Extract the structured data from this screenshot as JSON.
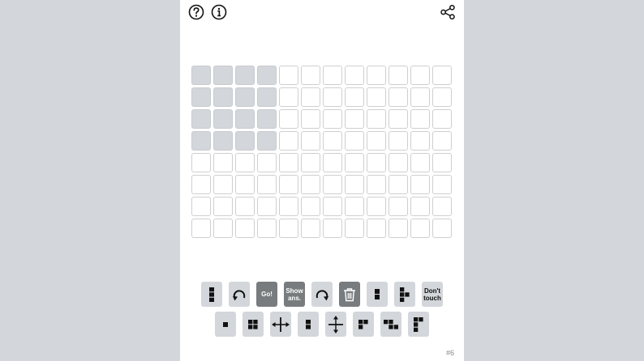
{
  "header": {
    "help_icon": "question-circle-icon",
    "info_icon": "info-circle-icon",
    "share_icon": "share-icon"
  },
  "grid": {
    "rows": 8,
    "cols": 12,
    "filled_region": {
      "rows": 4,
      "cols": 4
    },
    "filled_color": "#d3d6da"
  },
  "toolbar_row1": [
    {
      "name": "piece-vertical-3-button",
      "icon": "vertical-bar-3-icon"
    },
    {
      "name": "undo-button",
      "icon": "rotate-left-icon"
    },
    {
      "name": "go-button",
      "label": "Go!"
    },
    {
      "name": "show-answer-button",
      "label": "Show ans."
    },
    {
      "name": "redo-button",
      "icon": "rotate-right-icon"
    },
    {
      "name": "trash-button",
      "icon": "trash-icon"
    },
    {
      "name": "piece-vertical-2-button",
      "icon": "vertical-bar-2-icon"
    },
    {
      "name": "piece-t-button",
      "icon": "t-piece-icon"
    },
    {
      "name": "dont-touch-button",
      "label": "Don't touch"
    }
  ],
  "toolbar_row2": [
    {
      "name": "piece-single-button",
      "icon": "single-square-icon"
    },
    {
      "name": "piece-square-button",
      "icon": "square-2x2-icon"
    },
    {
      "name": "flip-horizontal-button",
      "icon": "flip-horizontal-icon"
    },
    {
      "name": "piece-vertical-2b-button",
      "icon": "vertical-bar-2-icon"
    },
    {
      "name": "flip-vertical-button",
      "icon": "flip-vertical-icon"
    },
    {
      "name": "piece-corner-button",
      "icon": "corner-piece-icon"
    },
    {
      "name": "piece-z-button",
      "icon": "z-piece-icon"
    },
    {
      "name": "piece-l-button",
      "icon": "l-piece-icon"
    }
  ],
  "footer": {
    "puzzle_number": "#6"
  },
  "colors": {
    "background": "#d3d6da",
    "button": "#d3d6da",
    "button_dark": "#787c7e"
  }
}
